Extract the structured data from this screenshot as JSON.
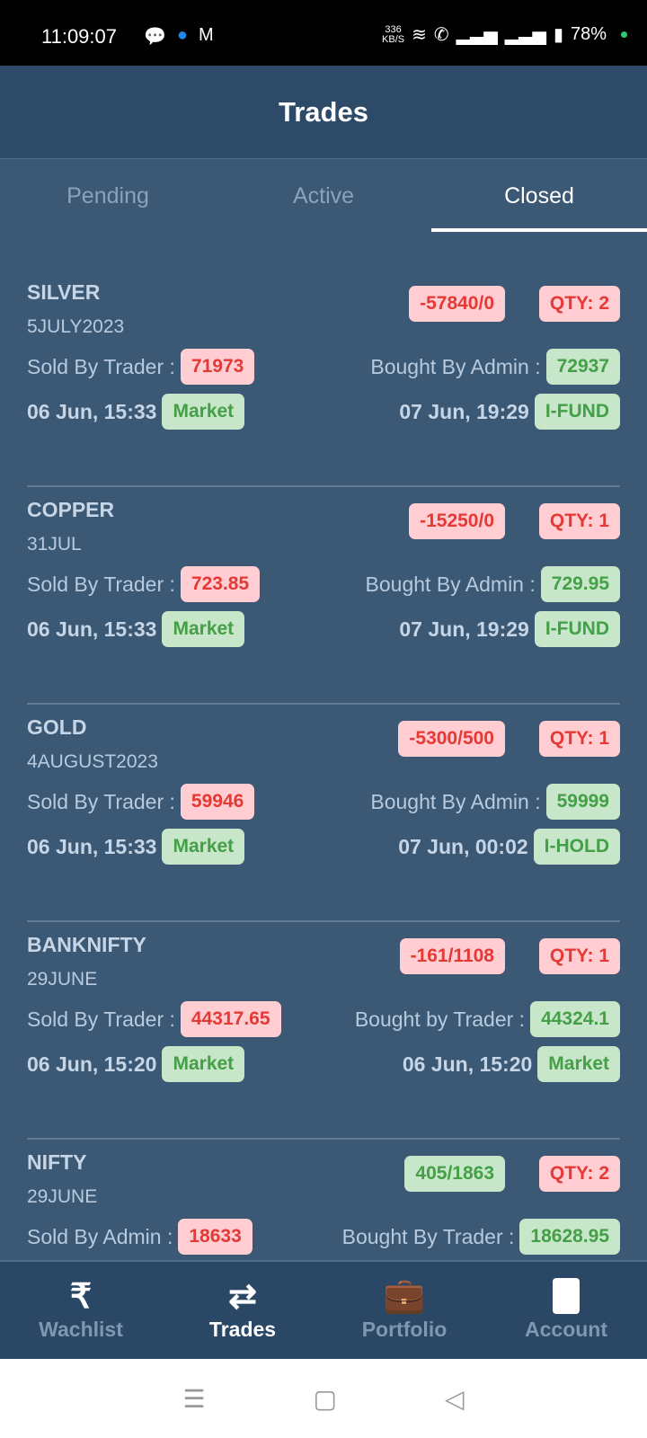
{
  "status_bar": {
    "time": "11:09:07",
    "speed": "336",
    "speed_unit": "KB/S",
    "battery": "78%"
  },
  "header": {
    "title": "Trades"
  },
  "tabs": [
    {
      "label": "Pending"
    },
    {
      "label": "Active"
    },
    {
      "label": "Closed",
      "active": true
    }
  ],
  "colors": {
    "loss_bg": "#ffcdd2",
    "loss_text": "#e53935",
    "gain_bg": "#c8e6c9",
    "gain_text": "#43a047",
    "background": "#3b5874"
  },
  "trades": [
    {
      "symbol": "SILVER",
      "expiry": "5JULY2023",
      "pnl": "-57840/0",
      "pnl_type": "loss",
      "qty": "QTY: 2",
      "sell_label": "Sold By Trader :",
      "sell_price": "71973",
      "buy_label": "Bought By Admin :",
      "buy_price": "72937",
      "sell_time": "06 Jun, 15:33",
      "sell_type": "Market",
      "buy_time": "07 Jun, 19:29",
      "buy_type": "I-FUND"
    },
    {
      "symbol": "COPPER",
      "expiry": "31JUL",
      "pnl": "-15250/0",
      "pnl_type": "loss",
      "qty": "QTY: 1",
      "sell_label": "Sold By Trader :",
      "sell_price": "723.85",
      "buy_label": "Bought By Admin :",
      "buy_price": "729.95",
      "sell_time": "06 Jun, 15:33",
      "sell_type": "Market",
      "buy_time": "07 Jun, 19:29",
      "buy_type": "I-FUND"
    },
    {
      "symbol": "GOLD",
      "expiry": "4AUGUST2023",
      "pnl": "-5300/500",
      "pnl_type": "loss",
      "qty": "QTY: 1",
      "sell_label": "Sold By Trader :",
      "sell_price": "59946",
      "buy_label": "Bought By Admin :",
      "buy_price": "59999",
      "sell_time": "06 Jun, 15:33",
      "sell_type": "Market",
      "buy_time": "07 Jun, 00:02",
      "buy_type": "I-HOLD"
    },
    {
      "symbol": "BANKNIFTY",
      "expiry": "29JUNE",
      "pnl": "-161/1108",
      "pnl_type": "loss",
      "qty": "QTY: 1",
      "sell_label": "Sold By Trader :",
      "sell_price": "44317.65",
      "buy_label": "Bought by Trader :",
      "buy_price": "44324.1",
      "sell_time": "06 Jun, 15:20",
      "sell_type": "Market",
      "buy_time": "06 Jun, 15:20",
      "buy_type": "Market"
    },
    {
      "symbol": "NIFTY",
      "expiry": "29JUNE",
      "pnl": "405/1863",
      "pnl_type": "gain",
      "qty": "QTY: 2",
      "sell_label": "Sold By Admin :",
      "sell_price": "18633",
      "buy_label": "Bought By Trader :",
      "buy_price": "18628.95",
      "sell_time": "",
      "sell_type": "",
      "buy_time": "",
      "buy_type": ""
    }
  ],
  "bottom_nav": [
    {
      "label": "Wachlist",
      "icon": "rupee-icon"
    },
    {
      "label": "Trades",
      "icon": "trades-exchange-icon",
      "active": true
    },
    {
      "label": "Portfolio",
      "icon": "briefcase-icon"
    },
    {
      "label": "Account",
      "icon": "account-icon"
    }
  ]
}
